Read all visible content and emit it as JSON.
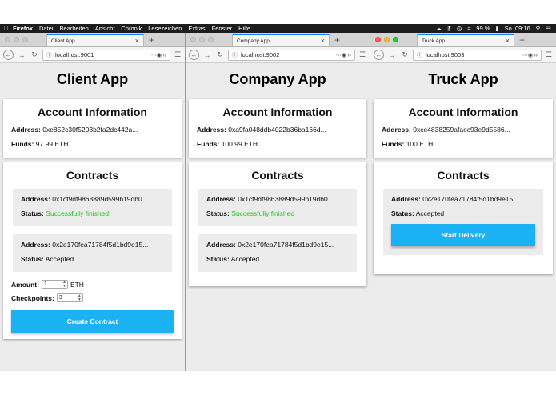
{
  "menubar": {
    "app": "Firefox",
    "items": [
      "Datei",
      "Bearbeiten",
      "Ansicht",
      "Chronik",
      "Lesezeichen",
      "Extras",
      "Fenster",
      "Hilfe"
    ],
    "battery": "99 %",
    "clock": "So. 09:16"
  },
  "windows": [
    {
      "tab_title": "Client App",
      "url": "localhost:9001",
      "page": {
        "title": "Client App",
        "account": {
          "heading": "Account Information",
          "address_label": "Address:",
          "address": "0xe852c30f5203b2fa2dc442a...",
          "funds_label": "Funds:",
          "funds": "97.99 ETH"
        },
        "contracts": {
          "heading": "Contracts",
          "items": [
            {
              "address_label": "Address:",
              "address": "0x1cf9df9863889d599b19db0...",
              "status_label": "Status:",
              "status": "Successfully finished"
            },
            {
              "address_label": "Address:",
              "address": "0x2e170fea71784f5d1bd9e15...",
              "status_label": "Status:",
              "status": "Accepted"
            }
          ],
          "form": {
            "amount_label": "Amount:",
            "amount_value": "1",
            "amount_unit": "ETH",
            "checkpoints_label": "Checkpoints:",
            "checkpoints_value": "3",
            "button": "Create Contract"
          }
        }
      }
    },
    {
      "tab_title": "Company App",
      "url": "localhost:9002",
      "page": {
        "title": "Company App",
        "account": {
          "heading": "Account Information",
          "address_label": "Address:",
          "address": "0xa9fa048ddb4022b36ba166d...",
          "funds_label": "Funds:",
          "funds": "100.99 ETH"
        },
        "contracts": {
          "heading": "Contracts",
          "items": [
            {
              "address_label": "Address:",
              "address": "0x1cf9df9863889d599b19db0...",
              "status_label": "Status:",
              "status": "Successfully finished"
            },
            {
              "address_label": "Address:",
              "address": "0x2e170fea71784f5d1bd9e15...",
              "status_label": "Status:",
              "status": "Accepted"
            }
          ]
        }
      }
    },
    {
      "tab_title": "Truck App",
      "url": "localhost:9003",
      "page": {
        "title": "Truck App",
        "account": {
          "heading": "Account Information",
          "address_label": "Address:",
          "address": "0xce4838259afaec93e9d5586...",
          "funds_label": "Funds:",
          "funds": "100 ETH"
        },
        "contracts": {
          "heading": "Contracts",
          "items": [
            {
              "address_label": "Address:",
              "address": "0x2e170fea71784f5d1bd9e15...",
              "status_label": "Status:",
              "status": "Accepted"
            }
          ],
          "button": "Start Delivery"
        }
      }
    }
  ],
  "colors": {
    "accent": "#1ab2f2",
    "success": "#22c322",
    "tab_highlight": "#0a84ff"
  }
}
